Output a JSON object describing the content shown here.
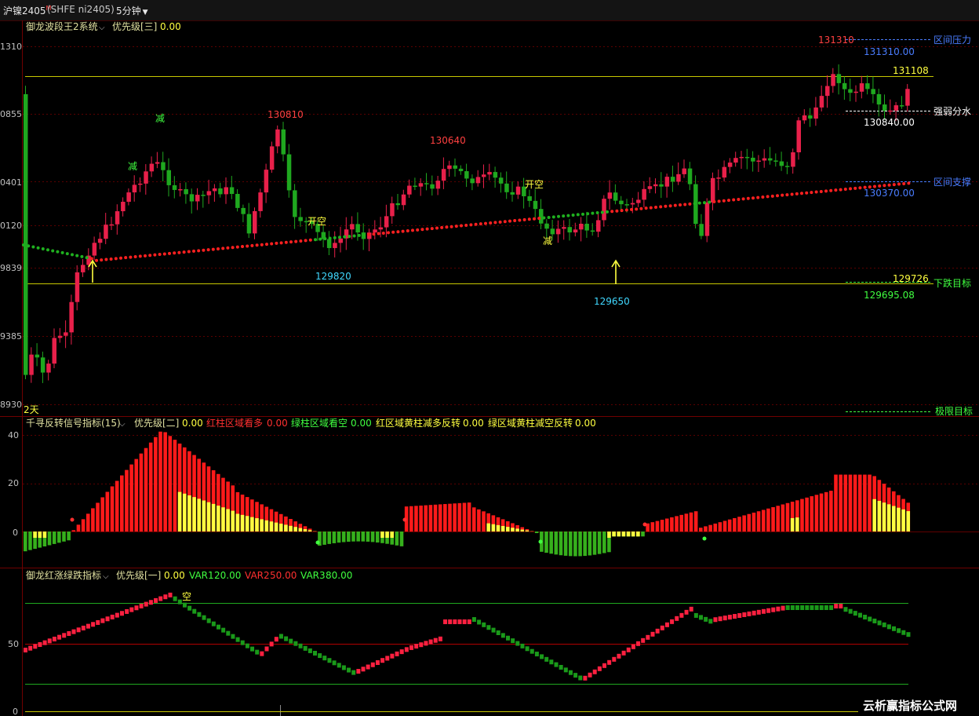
{
  "topbar": {
    "symbol": "沪镍2405",
    "symbol_badge": "M",
    "code": "(SHFE ni2405)",
    "period": "5分钟"
  },
  "main_panel": {
    "indicator_name": "御龙波段王2系统",
    "priority_label": "优先级[三]",
    "priority_value": "0.00",
    "y_ticks": [
      "1310",
      "0855",
      "0401",
      "0120",
      "9839",
      "9385",
      "8930"
    ],
    "days_label": "2天",
    "labels": {
      "peak_a": "130810",
      "peak_b": "130640",
      "peak_c": "131310",
      "low_a": "129820",
      "low_b": "129650",
      "open_short_a": "开空",
      "open_short_b": "开空",
      "reduce_a": "减",
      "reduce_b": "减",
      "reduce_c": "减"
    },
    "levels": [
      {
        "price": "131310.00",
        "name": "区间压力"
      },
      {
        "price": "131108",
        "name": ""
      },
      {
        "price": "130840.00",
        "name": "强弱分水"
      },
      {
        "price": "130370.00",
        "name": "区间支撑"
      },
      {
        "price": "129726",
        "name": ""
      },
      {
        "price": "129695.08",
        "name": "下跌目标"
      },
      {
        "price": "",
        "name": "极限目标"
      }
    ]
  },
  "mid_panel": {
    "title": "千寻反转信号指标(15)",
    "priority_label": "优先级[二]",
    "priority_value": "0.00",
    "legend": [
      {
        "label": "红柱区域看多",
        "value": "0.00"
      },
      {
        "label": "绿柱区域看空",
        "value": "0.00"
      },
      {
        "label": "红区域黄柱减多反转",
        "value": "0.00"
      },
      {
        "label": "绿区域黄柱减空反转",
        "value": "0.00"
      }
    ],
    "y_ticks": [
      "40",
      "20",
      "0"
    ]
  },
  "bottom_panel": {
    "title": "御龙红涨绿跌指标",
    "priority_label": "优先级[一]",
    "priority_value": "0.00",
    "vars": [
      {
        "label": "VAR1",
        "value": "20.00"
      },
      {
        "label": "VAR2",
        "value": "50.00"
      },
      {
        "label": "VAR3",
        "value": "80.00"
      }
    ],
    "signal_label": "空",
    "y_ticks": [
      "50",
      "0"
    ]
  },
  "watermark": "云析赢指标公式网",
  "colors": {
    "up": "#e8204a",
    "down": "#1fa81f",
    "bar_red": "#ff1a1a",
    "bar_yellow": "#ffff40",
    "bar_green": "#36b01c",
    "label_yellow": "#ffff40",
    "label_cyan": "#40d8ff",
    "label_blue": "#4a7dff",
    "label_green": "#40ff40"
  }
}
